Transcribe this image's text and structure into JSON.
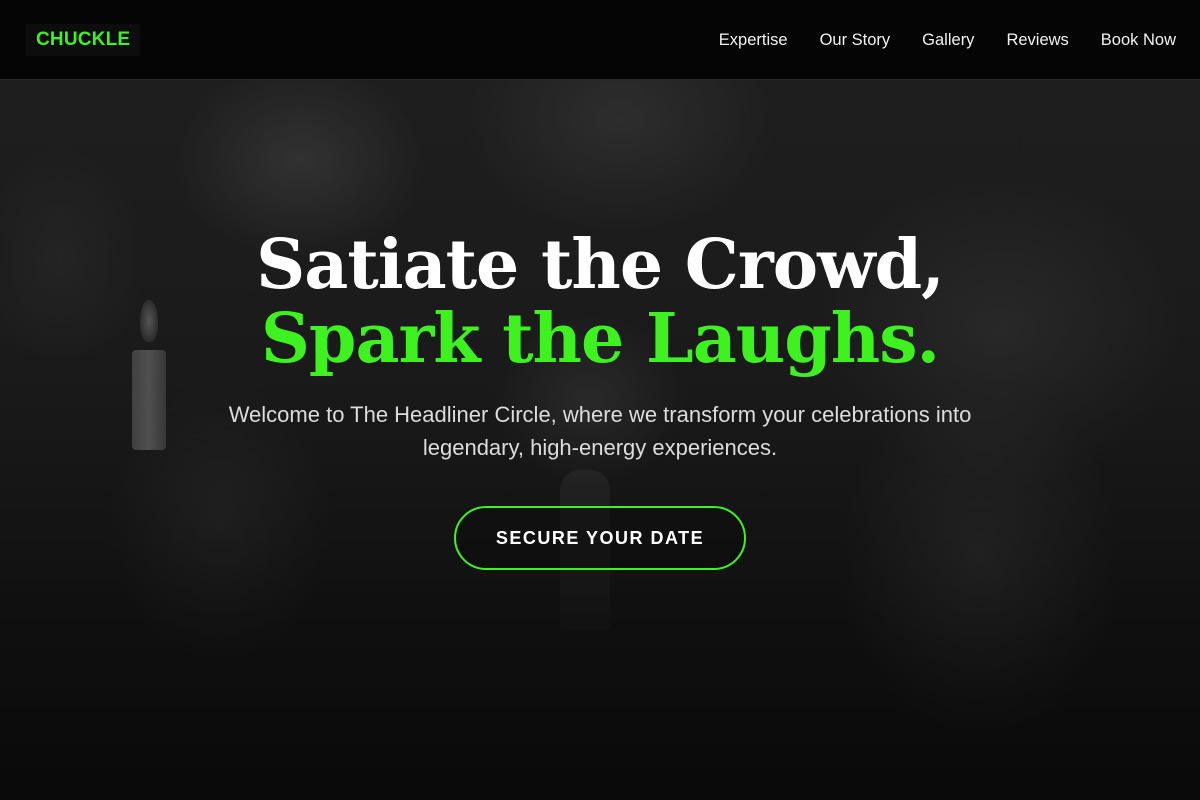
{
  "brand": {
    "logo_text": "CHUCKLE",
    "accent_color": "#3df21f"
  },
  "nav": {
    "items": [
      {
        "label": "Expertise"
      },
      {
        "label": "Our Story"
      },
      {
        "label": "Gallery"
      },
      {
        "label": "Reviews"
      },
      {
        "label": "Book Now"
      }
    ]
  },
  "hero": {
    "headline_main": "Satiate the Crowd, ",
    "headline_accent": "Spark the Laughs.",
    "subtext": "Welcome to The Headliner Circle, where we transform your celebrations into legendary, high-energy experiences.",
    "cta_label": "SECURE YOUR DATE"
  }
}
